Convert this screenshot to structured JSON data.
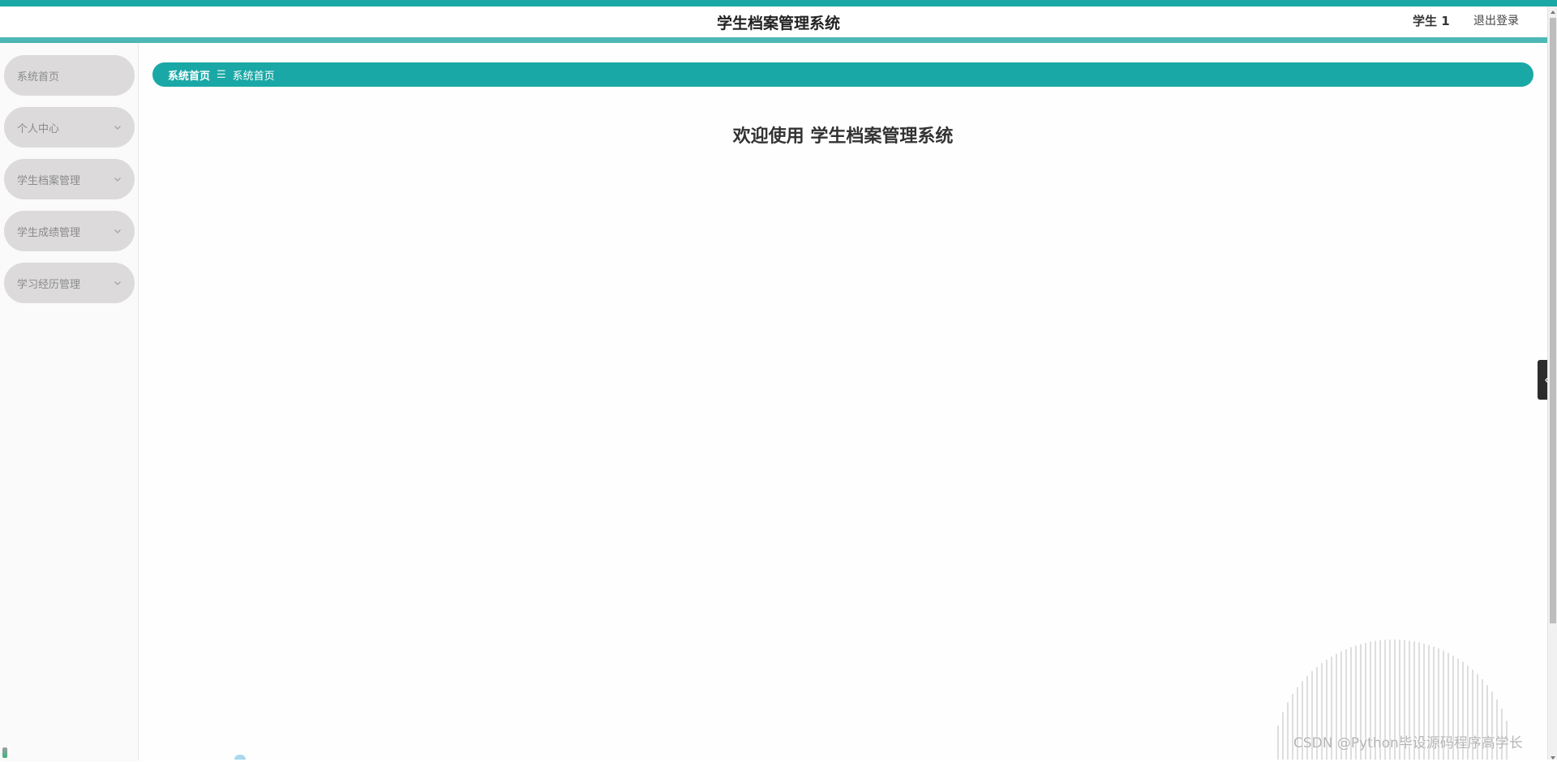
{
  "header": {
    "title": "学生档案管理系统",
    "user": "学生 1",
    "logout_label": "退出登录"
  },
  "sidebar": {
    "items": [
      {
        "label": "系统首页",
        "has_children": false
      },
      {
        "label": "个人中心",
        "has_children": true
      },
      {
        "label": "学生档案管理",
        "has_children": true
      },
      {
        "label": "学生成绩管理",
        "has_children": true
      },
      {
        "label": "学习经历管理",
        "has_children": true
      }
    ]
  },
  "breadcrumb": {
    "root": "系统首页",
    "separator": "☰",
    "current": "系统首页"
  },
  "main": {
    "welcome": "欢迎使用 学生档案管理系统"
  },
  "watermark": "CSDN @Python毕设源码程序高学长",
  "theme": {
    "accent": "#1aa8a6",
    "menu_bg": "#dcdadb",
    "menu_text": "#8b8b8b"
  }
}
